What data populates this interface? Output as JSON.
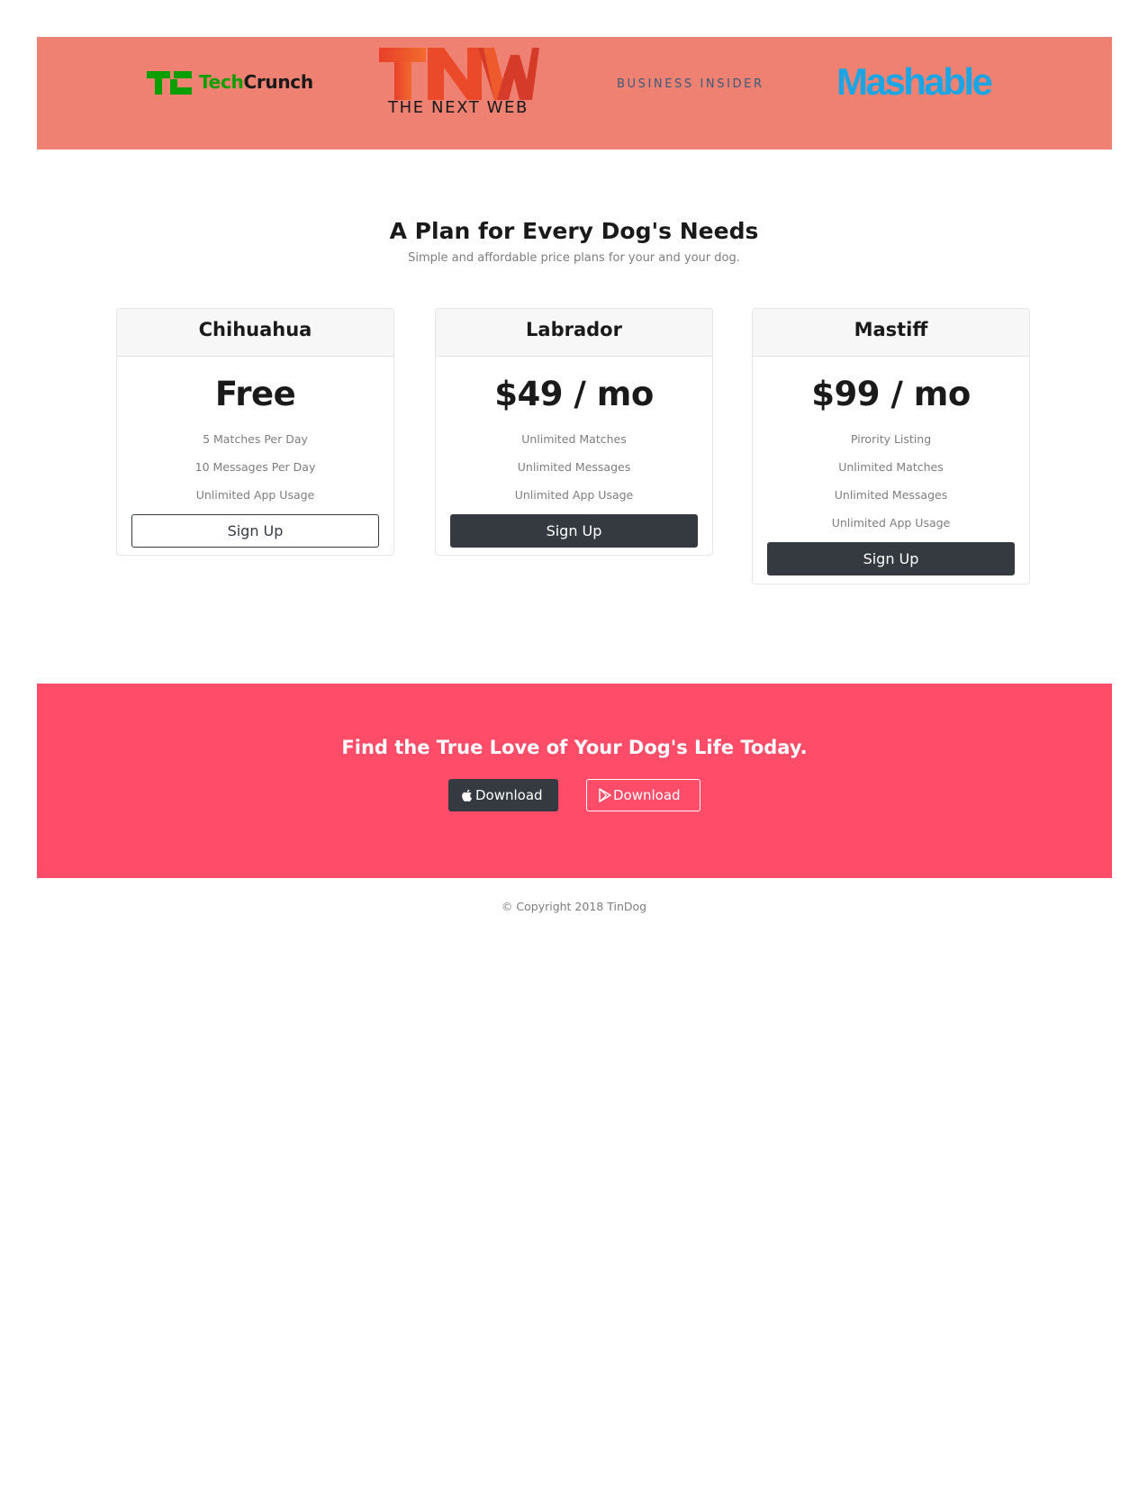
{
  "press": {
    "techcrunch": {
      "part_a": "Tech",
      "part_b": "Crunch"
    },
    "tnw": {
      "mark": "TNW",
      "subtitle": "THE NEXT WEB"
    },
    "business_insider": {
      "name": "BUSINESS INSIDER"
    },
    "mashable": {
      "name": "Mashable"
    },
    "colors": {
      "band": "#ef8172",
      "techcrunch_green": "#0a9e01",
      "tnw_red": "#ea4a2a",
      "mashable_blue": "#1aa6e5"
    }
  },
  "pricing": {
    "title": "A Plan for Every Dog's Needs",
    "subtitle": "Simple and affordable price plans for your and your dog.",
    "plans": [
      {
        "name": "Chihuahua",
        "price": "Free",
        "features": [
          "5 Matches Per Day",
          "10 Messages Per Day",
          "Unlimited App Usage"
        ],
        "button": "Sign Up",
        "button_style": "outline"
      },
      {
        "name": "Labrador",
        "price": "$49 / mo",
        "features": [
          "Unlimited Matches",
          "Unlimited Messages",
          "Unlimited App Usage"
        ],
        "button": "Sign Up",
        "button_style": "dark"
      },
      {
        "name": "Mastiff",
        "price": "$99 / mo",
        "features": [
          "Pirority Listing",
          "Unlimited Matches",
          "Unlimited Messages",
          "Unlimited App Usage"
        ],
        "button": "Sign Up",
        "button_style": "dark"
      }
    ]
  },
  "cta": {
    "title": "Find the True Love of Your Dog's Life Today.",
    "apple_button": {
      "label": "Download",
      "icon": "apple-icon"
    },
    "play_button": {
      "label": "Download",
      "icon": "google-play-icon"
    },
    "color": "#ff4c68"
  },
  "footer": {
    "copyright": "© Copyright 2018 TinDog"
  }
}
